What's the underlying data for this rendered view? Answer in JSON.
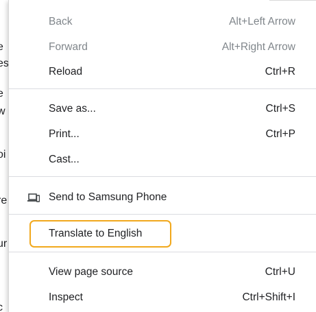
{
  "background": {
    "fragments": [
      "e",
      "es",
      "e",
      "w",
      "oi",
      "re",
      "ur",
      "c"
    ]
  },
  "menu": {
    "back": {
      "label": "Back",
      "shortcut": "Alt+Left Arrow",
      "enabled": false
    },
    "forward": {
      "label": "Forward",
      "shortcut": "Alt+Right Arrow",
      "enabled": false
    },
    "reload": {
      "label": "Reload",
      "shortcut": "Ctrl+R",
      "enabled": true
    },
    "save_as": {
      "label": "Save as...",
      "shortcut": "Ctrl+S",
      "enabled": true
    },
    "print": {
      "label": "Print...",
      "shortcut": "Ctrl+P",
      "enabled": true
    },
    "cast": {
      "label": "Cast...",
      "enabled": true
    },
    "send_to_device": {
      "label": "Send to Samsung Phone",
      "icon": "device-icon",
      "enabled": true
    },
    "translate": {
      "label": "Translate to English",
      "enabled": true,
      "highlighted": true
    },
    "view_source": {
      "label": "View page source",
      "shortcut": "Ctrl+U",
      "enabled": true
    },
    "inspect": {
      "label": "Inspect",
      "shortcut": "Ctrl+Shift+I",
      "enabled": true
    }
  },
  "colors": {
    "text": "#202124",
    "disabled_text": "#80868b",
    "separator": "#dadce0",
    "highlight_border": "#f1a81c"
  }
}
